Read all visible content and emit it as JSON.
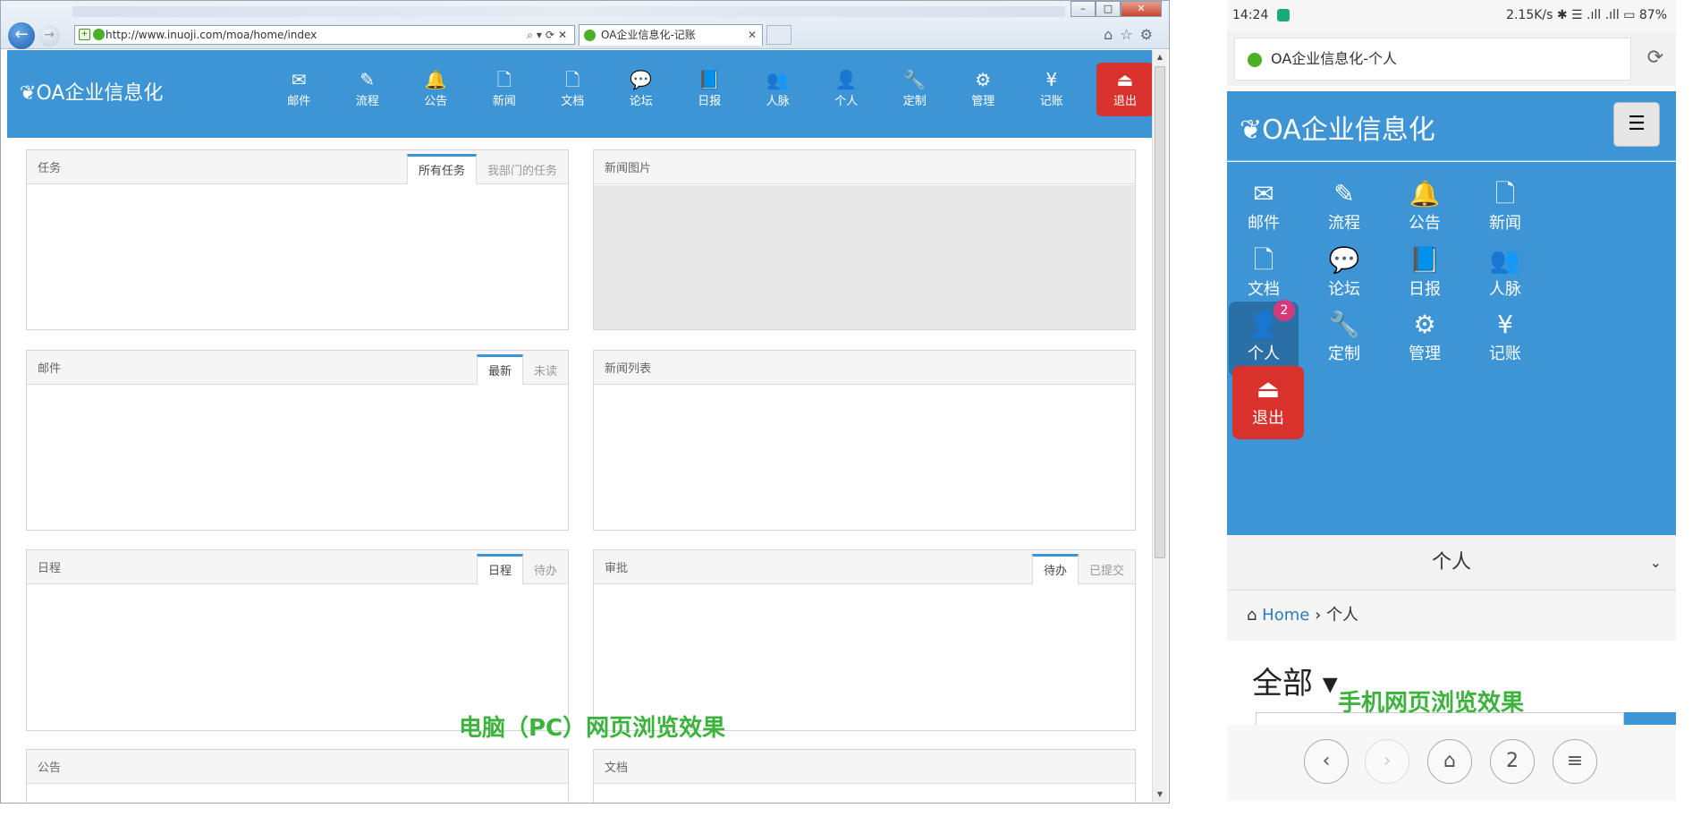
{
  "pc": {
    "url": "http://www.inuoji.com/moa/home/index",
    "tab_title": "OA企业信息化-记账",
    "brand": "OA企业信息化",
    "nav": [
      {
        "label": "邮件",
        "icon": "mail-icon",
        "glyph": "✉"
      },
      {
        "label": "流程",
        "icon": "pencil-icon",
        "glyph": "✎"
      },
      {
        "label": "公告",
        "icon": "bell-icon",
        "glyph": "🔔"
      },
      {
        "label": "新闻",
        "icon": "file-icon",
        "glyph": "🗋"
      },
      {
        "label": "文档",
        "icon": "document-icon",
        "glyph": "🗋"
      },
      {
        "label": "论坛",
        "icon": "comments-icon",
        "glyph": "💬"
      },
      {
        "label": "日报",
        "icon": "book-icon",
        "glyph": "📘"
      },
      {
        "label": "人脉",
        "icon": "users-icon",
        "glyph": "👥"
      },
      {
        "label": "个人",
        "icon": "user-icon",
        "glyph": "👤"
      },
      {
        "label": "定制",
        "icon": "wrench-icon",
        "glyph": "🔧"
      },
      {
        "label": "管理",
        "icon": "gears-icon",
        "glyph": "⚙"
      },
      {
        "label": "记账",
        "icon": "yen-icon",
        "glyph": "¥"
      }
    ],
    "exit": {
      "label": "退出",
      "glyph": "⏏"
    },
    "panels": {
      "task": {
        "title": "任务",
        "tabs": [
          "所有任务",
          "我部门的任务"
        ]
      },
      "news_images": {
        "title": "新闻图片"
      },
      "mail": {
        "title": "邮件",
        "tabs": [
          "最新",
          "未读"
        ]
      },
      "news_list": {
        "title": "新闻列表"
      },
      "schedule": {
        "title": "日程",
        "tabs": [
          "日程",
          "待办"
        ]
      },
      "approval": {
        "title": "审批",
        "tabs": [
          "待办",
          "已提交"
        ]
      },
      "notice": {
        "title": "公告"
      },
      "docs": {
        "title": "文档"
      }
    },
    "caption": "电脑（PC）网页浏览效果"
  },
  "mobile": {
    "status": {
      "time": "14:24",
      "right": "2.15K/s  ✱ ☰ .ıll .ıll ▭ 87%"
    },
    "page_title": "OA企业信息化-个人",
    "brand": "OA企业信息化",
    "nav": [
      {
        "label": "邮件",
        "glyph": "✉"
      },
      {
        "label": "流程",
        "glyph": "✎"
      },
      {
        "label": "公告",
        "glyph": "🔔"
      },
      {
        "label": "新闻",
        "glyph": "🗋"
      },
      {
        "label": "文档",
        "glyph": "🗋"
      },
      {
        "label": "论坛",
        "glyph": "💬"
      },
      {
        "label": "日报",
        "glyph": "📘"
      },
      {
        "label": "人脉",
        "glyph": "👥"
      },
      {
        "label": "个人",
        "glyph": "👤",
        "badge": "2"
      },
      {
        "label": "定制",
        "glyph": "🔧"
      },
      {
        "label": "管理",
        "glyph": "⚙"
      },
      {
        "label": "记账",
        "glyph": "¥"
      }
    ],
    "exit": {
      "label": "退出",
      "glyph": "⏏"
    },
    "section": "个人",
    "breadcrumb": {
      "home": "Home",
      "sep": "›",
      "current": "个人"
    },
    "all_label": "全部 ▾",
    "caption": "手机网页浏览效果",
    "bottom_nav": [
      "‹",
      "›",
      "⌂",
      "2",
      "≡"
    ]
  }
}
